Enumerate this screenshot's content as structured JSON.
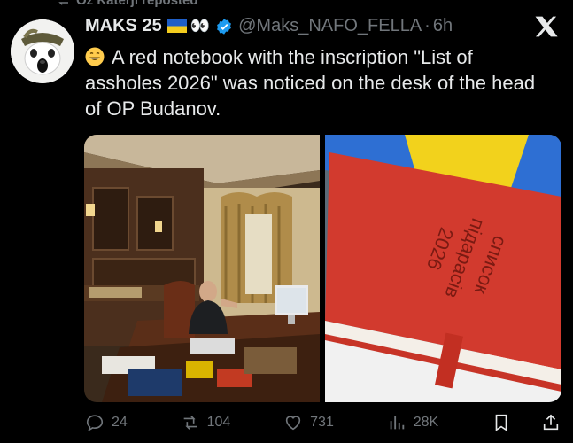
{
  "repost": {
    "label": "Oz Katerji reposted"
  },
  "author": {
    "name": "MAKS 25",
    "emojis": "👀",
    "handle": "@Maks_NAFO_FELLA",
    "separator": "·",
    "time": "6h"
  },
  "tweet": {
    "text": "A red notebook with the inscription \"List of assholes 2026\" was noticed on the desk of the head of OP Budanov."
  },
  "media": {
    "notebook_inscription_line1": "список",
    "notebook_inscription_line2": "підарасів",
    "notebook_inscription_line3": "2026"
  },
  "actions": {
    "replies": "24",
    "reposts": "104",
    "likes": "731",
    "views": "28K"
  },
  "colors": {
    "background": "#000000",
    "text": "#e7e9ea",
    "muted": "#71767b",
    "verified": "#1d9bf0",
    "notebook_red": "#d23a2e"
  }
}
